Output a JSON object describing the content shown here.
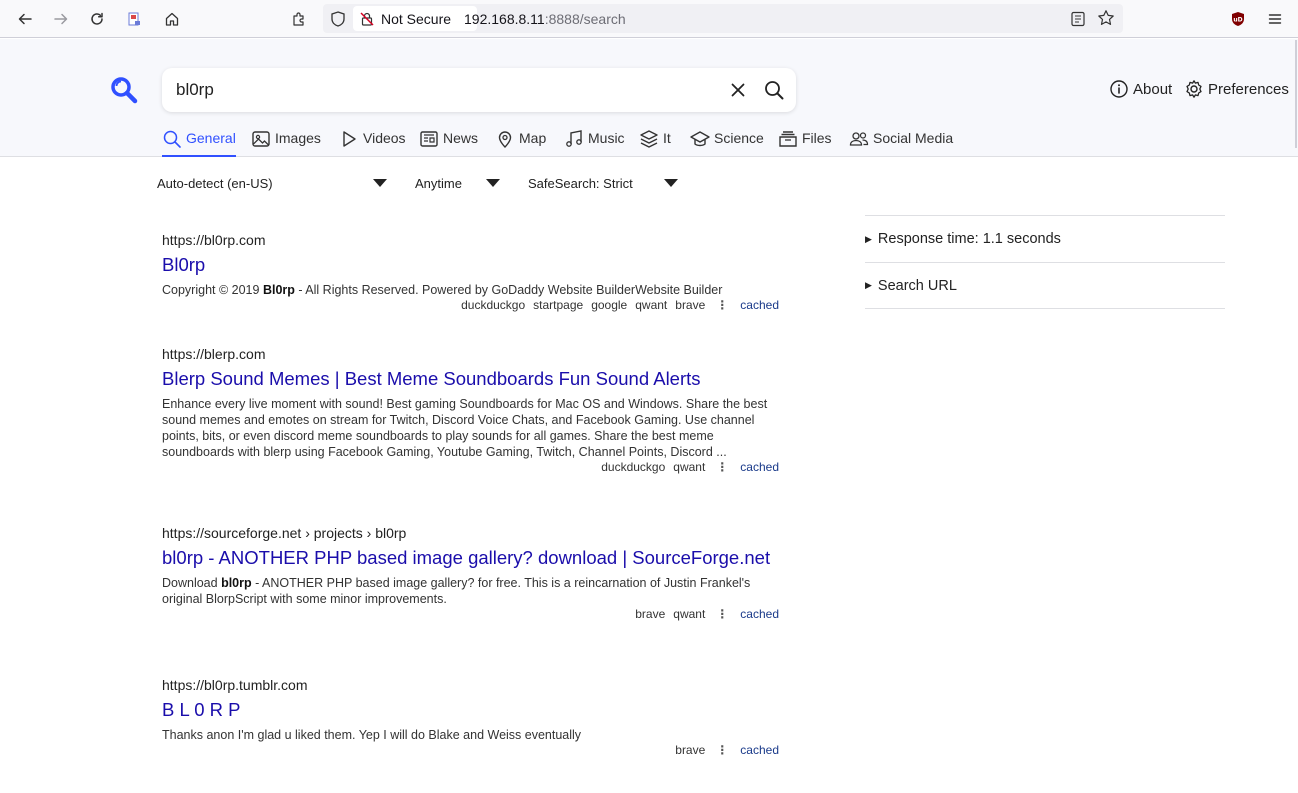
{
  "browser": {
    "security_label": "Not Secure",
    "url_host": "192.168.8.11",
    "url_rest": ":8888/search"
  },
  "search": {
    "query": "bl0rp"
  },
  "header_links": {
    "about": "About",
    "preferences": "Preferences"
  },
  "tabs": [
    {
      "label": "General",
      "icon": "search-icon",
      "active": true
    },
    {
      "label": "Images",
      "icon": "image-icon"
    },
    {
      "label": "Videos",
      "icon": "play-icon"
    },
    {
      "label": "News",
      "icon": "newspaper-icon"
    },
    {
      "label": "Map",
      "icon": "map-pin-icon"
    },
    {
      "label": "Music",
      "icon": "music-icon"
    },
    {
      "label": "It",
      "icon": "layers-icon"
    },
    {
      "label": "Science",
      "icon": "school-icon"
    },
    {
      "label": "Files",
      "icon": "files-icon"
    },
    {
      "label": "Social Media",
      "icon": "people-icon"
    }
  ],
  "filters": {
    "language": "Auto-detect (en-US)",
    "time": "Anytime",
    "safesearch": "SafeSearch: Strict"
  },
  "results": [
    {
      "url": "https://bl0rp.com",
      "breadcrumb": "",
      "title": "Bl0rp",
      "snippet_pre": "Copyright © 2019 ",
      "snippet_bold": "Bl0rp",
      "snippet_post": " - All Rights Reserved. Powered by GoDaddy Website BuilderWebsite Builder",
      "engines": [
        "duckduckgo",
        "startpage",
        "google",
        "qwant",
        "brave"
      ],
      "cached": "cached"
    },
    {
      "url": "https://blerp.com",
      "breadcrumb": "",
      "title": "Blerp Sound Memes | Best Meme Soundboards Fun Sound Alerts",
      "snippet_pre": "Enhance every live moment with sound! Best gaming Soundboards for Mac OS and Windows. Share the best sound memes and emotes on stream for Twitch, Discord Voice Chats, and Facebook Gaming. Use channel points, bits, or even discord meme soundboards to play sounds for all games. Share the best meme soundboards with blerp using Facebook Gaming, Youtube Gaming, Twitch, Channel Points, Discord ...",
      "snippet_bold": "",
      "snippet_post": "",
      "engines": [
        "duckduckgo",
        "qwant"
      ],
      "cached": "cached"
    },
    {
      "url": "https://sourceforge.net",
      "breadcrumb": " › projects › bl0rp",
      "title": "bl0rp - ANOTHER PHP based image gallery? download | SourceForge.net",
      "snippet_pre": "Download ",
      "snippet_bold": "bl0rp",
      "snippet_post": " - ANOTHER PHP based image gallery? for free. This is a reincarnation of Justin Frankel's original BlorpScript with some minor improvements.",
      "engines": [
        "brave",
        "qwant"
      ],
      "cached": "cached"
    },
    {
      "url": "https://bl0rp.tumblr.com",
      "breadcrumb": "",
      "title": "B L 0 R P",
      "snippet_pre": "Thanks anon I'm glad u liked them. Yep I will do Blake and Weiss eventually",
      "snippet_bold": "",
      "snippet_post": "",
      "engines": [
        "brave"
      ],
      "cached": "cached"
    }
  ],
  "sidebar": {
    "response_time": "Response time: 1.1 seconds",
    "search_url": "Search URL"
  }
}
